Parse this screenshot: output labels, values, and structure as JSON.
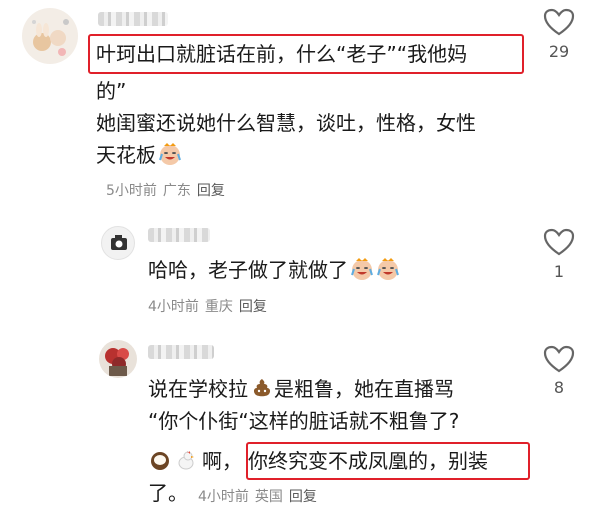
{
  "comments": [
    {
      "lines": [
        "叶珂出口就脏话在前，什么“老子”“我他妈",
        "的”",
        "她闺蜜还说她什么智慧，谈吐，性格，女性",
        "天花板"
      ],
      "time": "5小时前",
      "location": "广东",
      "reply": "回复",
      "likes": "29",
      "emoji": "crying-laughing-face"
    },
    {
      "lines": [
        "哈哈，老子做了就做了"
      ],
      "time": "4小时前",
      "location": "重庆",
      "reply": "回复",
      "likes": "1",
      "emoji": "crying-laughing-face"
    },
    {
      "lines": [
        "说在学校拉",
        "是粗鲁，她在直播骂",
        "“你个仆街“这样的脏话就不粗鲁了?",
        "啊，",
        "你终究变不成凤凰的，别装",
        "了。"
      ],
      "time": "4小时前",
      "location": "英国",
      "reply": "回复",
      "likes": "8",
      "emoji": "poop, coconut, chicken"
    }
  ],
  "colors": {
    "highlight": "#e0202a",
    "meta": "#8a8a8a"
  }
}
